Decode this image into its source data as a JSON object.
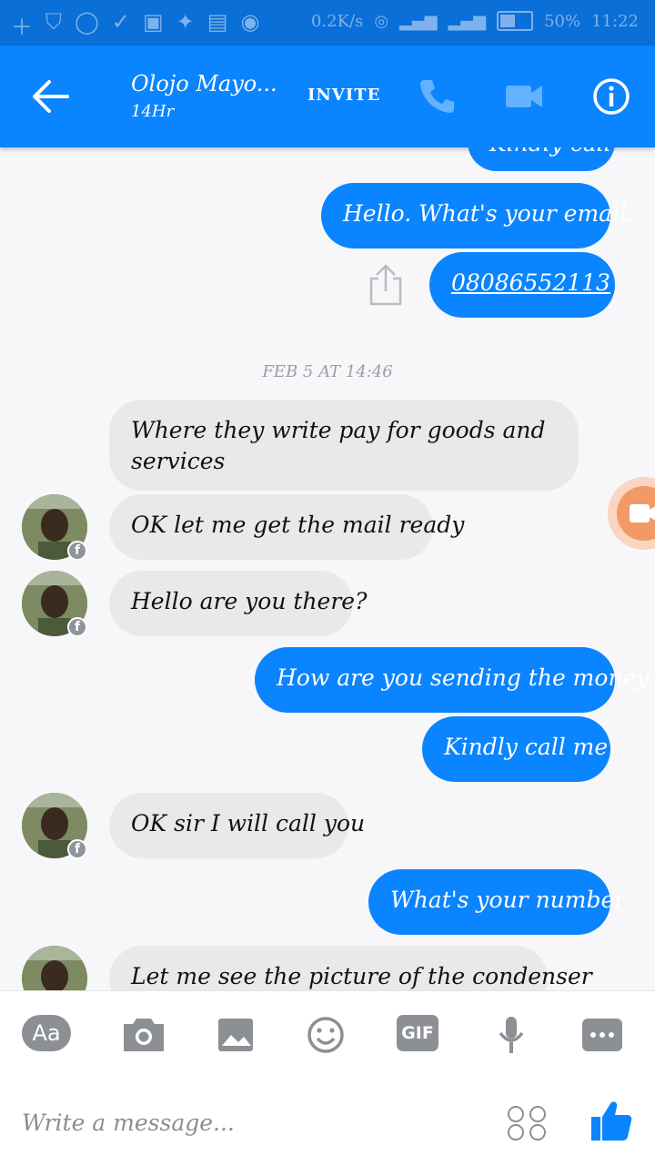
{
  "status": {
    "speed": "0.2K/s",
    "battery": "50%",
    "time": "11:22"
  },
  "header": {
    "title": "Olojo Mayo...",
    "subtitle": "14Hr",
    "invite": "INVITE"
  },
  "chat": {
    "top_partial": "Kindly call",
    "m1": "Hello. What's your email.",
    "m2": "08086552113",
    "date": "FEB 5 AT 14:46",
    "m3_line1": "Where they write pay for goods and",
    "m3_line2": "services",
    "m4": "OK let me get the mail ready",
    "m5": "Hello are you there?",
    "m6": "How are you sending the money",
    "m7": "Kindly call me.",
    "m8": "OK sir I will call you",
    "m9": "What's your number",
    "m10": "Let me see the picture of the condenser"
  },
  "composer": {
    "aa": "Aa",
    "gif": "GIF",
    "placeholder": "Write a message..."
  },
  "colors": {
    "brand_blue": "#0a84ff",
    "status_blue": "#0a6fd6",
    "incoming_bubble": "#e9e9eb",
    "video_fab": "#f19a65"
  }
}
